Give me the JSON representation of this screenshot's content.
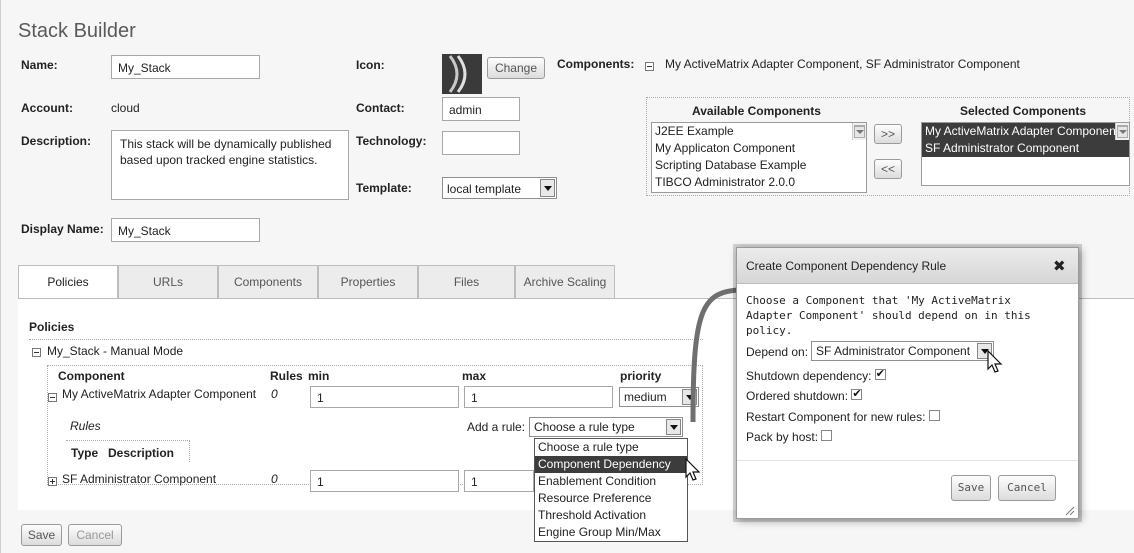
{
  "app_title": "Stack Builder",
  "form": {
    "name_label": "Name:",
    "name_value": "My_Stack",
    "account_label": "Account:",
    "account_value": "cloud",
    "description_label": "Description:",
    "description_value": "This stack will be dynamically published based upon tracked engine statistics.",
    "display_name_label": "Display Name:",
    "display_name_value": "My_Stack",
    "icon_label": "Icon:",
    "change_button": "Change",
    "contact_label": "Contact:",
    "contact_value": "admin",
    "technology_label": "Technology:",
    "technology_value": "",
    "template_label": "Template:",
    "template_value": "local template",
    "components_label": "Components:",
    "components_value": "My ActiveMatrix Adapter Component, SF Administrator Component"
  },
  "components_picker": {
    "available_title": "Available Components",
    "available": [
      "J2EE Example",
      "My Applicaton Component",
      "Scripting Database Example",
      "TIBCO Administrator 2.0.0"
    ],
    "selected_title": "Selected Components",
    "selected": [
      "My ActiveMatrix Adapter Component",
      "SF Administrator Component"
    ],
    "move_right": ">>",
    "move_left": "<<"
  },
  "tabs": [
    {
      "label": "Policies"
    },
    {
      "label": "URLs"
    },
    {
      "label": "Components"
    },
    {
      "label": "Properties"
    },
    {
      "label": "Files"
    },
    {
      "label": "Archive Scaling"
    }
  ],
  "policies": {
    "heading": "Policies",
    "tree_root": "My_Stack - Manual Mode",
    "col_component": "Component",
    "col_rules": "Rules",
    "col_min": "min",
    "col_max": "max",
    "col_priority": "priority",
    "rows": [
      {
        "component": "My ActiveMatrix Adapter Component",
        "rules": "0",
        "min": "1",
        "max": "1",
        "priority": "medium"
      },
      {
        "component": "SF Administrator Component",
        "rules": "0",
        "min": "1",
        "max": "1"
      }
    ],
    "rules_label": "Rules",
    "add_rule_label": "Add a rule:",
    "rule_select_value": "Choose a rule type",
    "rules_col_type": "Type",
    "rules_col_description": "Description",
    "rule_options": [
      "Choose a rule type",
      "Component Dependency",
      "Enablement Condition",
      "Resource Preference",
      "Threshold Activation",
      "Engine Group Min/Max"
    ],
    "rule_option_highlighted": "Component Dependency"
  },
  "footer": {
    "save": "Save",
    "cancel": "Cancel"
  },
  "dialog": {
    "title": "Create Component Dependency Rule",
    "close_glyph": "✖",
    "message": "Choose a Component that 'My ActiveMatrix Adapter Component' should depend on in this policy.",
    "depend_on_label": "Depend on:",
    "depend_on_value": "SF Administrator Component",
    "shutdown_dependency_label": "Shutdown dependency:",
    "shutdown_dependency_checked": true,
    "ordered_shutdown_label": "Ordered shutdown:",
    "ordered_shutdown_checked": true,
    "restart_label": "Restart Component for new rules:",
    "restart_checked": false,
    "pack_by_host_label": "Pack by host:",
    "pack_by_host_checked": false,
    "save": "Save",
    "cancel": "Cancel"
  }
}
